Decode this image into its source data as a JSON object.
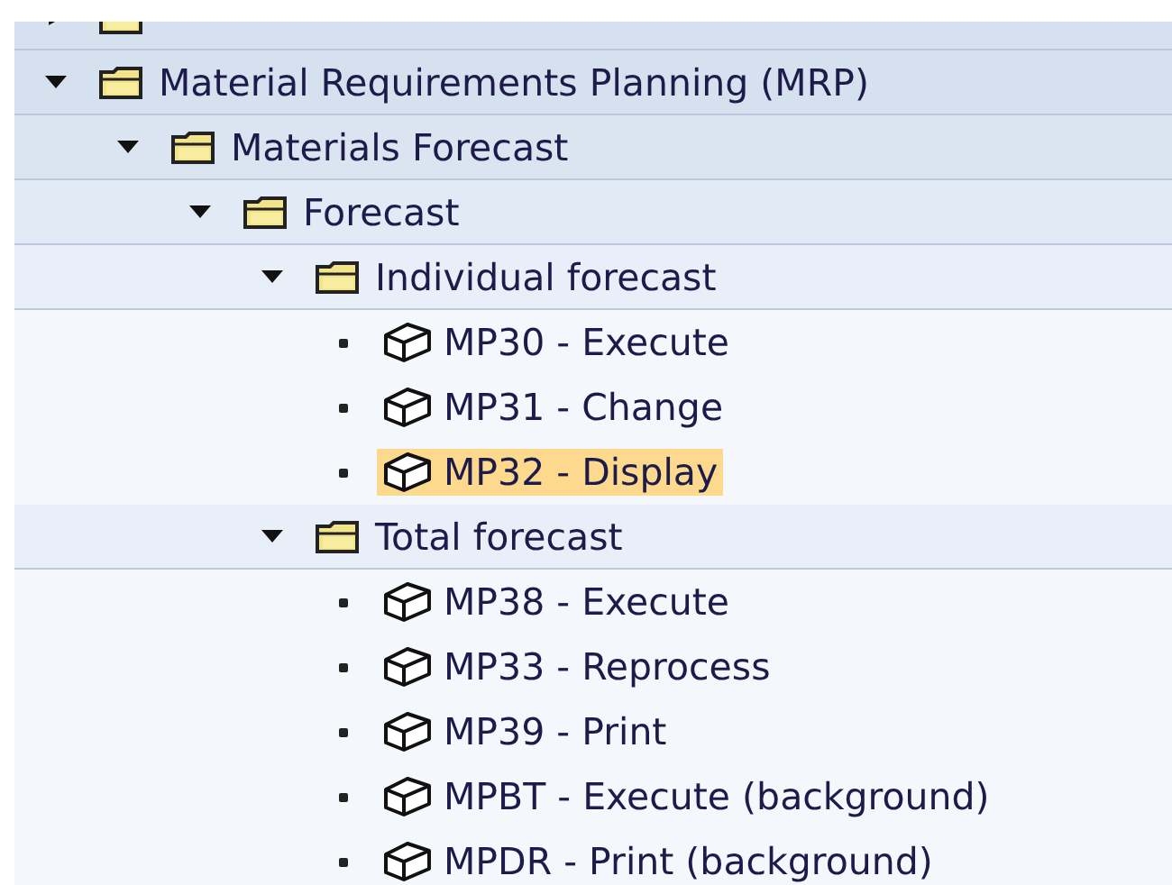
{
  "tree": [
    {
      "kind": "folder",
      "expanded": false,
      "selected": false
    },
    {
      "kind": "folder",
      "label": "Material Requirements Planning (MRP)",
      "expanded": true,
      "selected": false,
      "children": [
        {
          "kind": "folder",
          "label": "Materials Forecast",
          "expanded": true,
          "selected": false,
          "children": [
            {
              "kind": "folder",
              "label": "Forecast",
              "expanded": true,
              "selected": false,
              "children": [
                {
                  "kind": "folder",
                  "label": "Individual forecast",
                  "expanded": true,
                  "selected": false,
                  "children": [
                    {
                      "kind": "transaction",
                      "label": "MP30 - Execute",
                      "selected": false
                    },
                    {
                      "kind": "transaction",
                      "label": "MP31 - Change",
                      "selected": false
                    },
                    {
                      "kind": "transaction",
                      "label": "MP32 - Display",
                      "selected": true
                    }
                  ]
                },
                {
                  "kind": "folder",
                  "label": "Total forecast",
                  "expanded": true,
                  "selected": false,
                  "children": [
                    {
                      "kind": "transaction",
                      "label": "MP38 - Execute",
                      "selected": false
                    },
                    {
                      "kind": "transaction",
                      "label": "MP33 - Reprocess",
                      "selected": false
                    },
                    {
                      "kind": "transaction",
                      "label": "MP39 - Print",
                      "selected": false
                    },
                    {
                      "kind": "transaction",
                      "label": "MPBT - Execute (background)",
                      "selected": false
                    },
                    {
                      "kind": "transaction",
                      "label": "MPDR - Print (background)",
                      "selected": false
                    }
                  ]
                }
              ]
            }
          ]
        }
      ]
    }
  ]
}
